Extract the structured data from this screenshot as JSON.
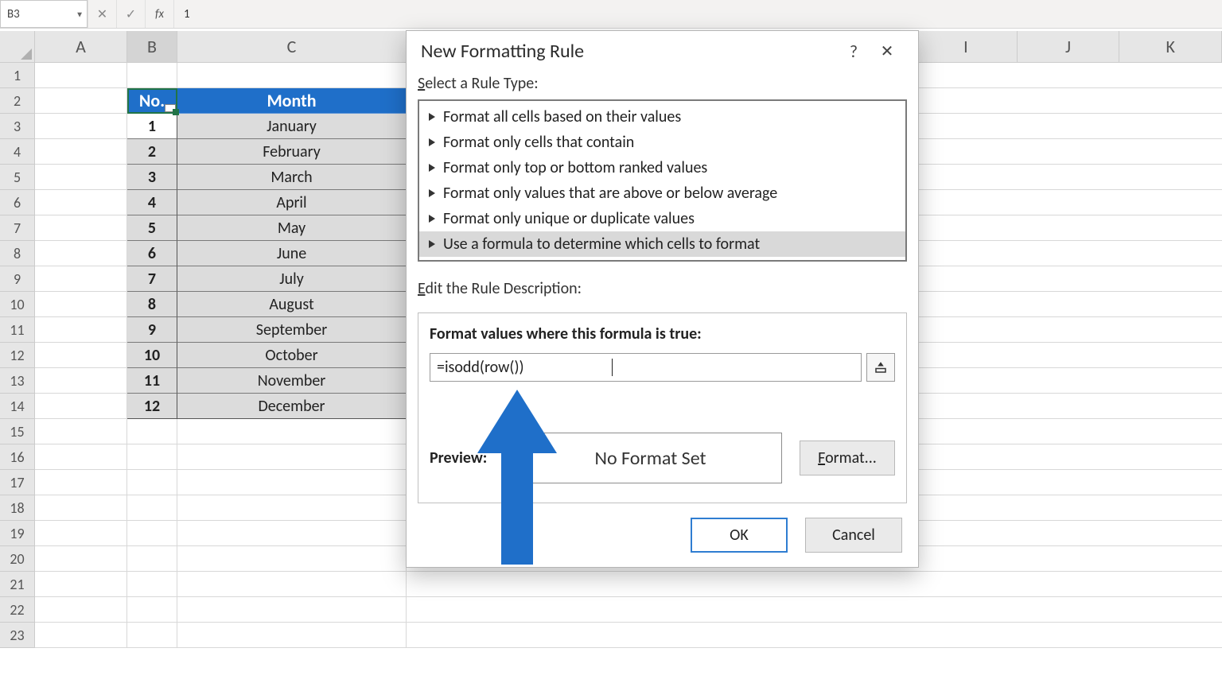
{
  "formula_bar": {
    "name_box": "B3",
    "cancel_glyph": "✕",
    "accept_glyph": "✓",
    "fx_label": "fx",
    "value": "1"
  },
  "columns_left": [
    "A",
    "B",
    "C"
  ],
  "columns_right": [
    "I",
    "J",
    "K"
  ],
  "row_count": 23,
  "table": {
    "headers": {
      "no": "No.",
      "month": "Month"
    },
    "rows": [
      {
        "no": "1",
        "month": "January"
      },
      {
        "no": "2",
        "month": "February"
      },
      {
        "no": "3",
        "month": "March"
      },
      {
        "no": "4",
        "month": "April"
      },
      {
        "no": "5",
        "month": "May"
      },
      {
        "no": "6",
        "month": "June"
      },
      {
        "no": "7",
        "month": "July"
      },
      {
        "no": "8",
        "month": "August"
      },
      {
        "no": "9",
        "month": "September"
      },
      {
        "no": "10",
        "month": "October"
      },
      {
        "no": "11",
        "month": "November"
      },
      {
        "no": "12",
        "month": "December"
      }
    ]
  },
  "active_cell": "B3",
  "dialog": {
    "title": "New Formatting Rule",
    "help": "?",
    "close": "✕",
    "select_rule_label": "Select a Rule Type:",
    "rule_types": [
      "Format all cells based on their values",
      "Format only cells that contain",
      "Format only top or bottom ranked values",
      "Format only values that are above or below average",
      "Format only unique or duplicate values",
      "Use a formula to determine which cells to format"
    ],
    "selected_rule_index": 5,
    "edit_desc_label": "Edit the Rule Description:",
    "formula_label": "Format values where this formula is true:",
    "formula_value": "=isodd(row())",
    "preview_label": "Preview:",
    "preview_text": "No Format Set",
    "format_btn": "Format...",
    "ok": "OK",
    "cancel": "Cancel"
  }
}
